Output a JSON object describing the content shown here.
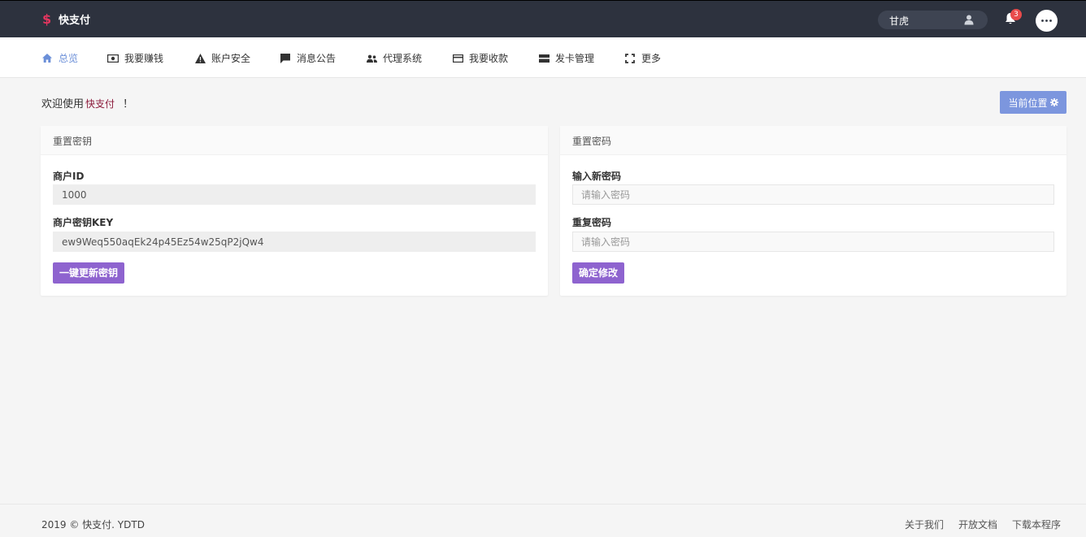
{
  "header": {
    "brand_symbol": "$",
    "brand_name": "快支付",
    "username": "甘虎",
    "notification_count": "3",
    "brand_color": "#e2365f",
    "bg_color": "#2d323e"
  },
  "nav": {
    "items": [
      {
        "label": "总览",
        "icon": "home-icon",
        "active": true
      },
      {
        "label": "我要赚钱",
        "icon": "money-icon"
      },
      {
        "label": "账户安全",
        "icon": "warning-icon"
      },
      {
        "label": "消息公告",
        "icon": "message-icon"
      },
      {
        "label": "代理系统",
        "icon": "users-icon"
      },
      {
        "label": "我要收款",
        "icon": "card-icon"
      },
      {
        "label": "发卡管理",
        "icon": "card-manage-icon"
      },
      {
        "label": "更多",
        "icon": "expand-icon"
      }
    ],
    "active_color": "#6b8fd8"
  },
  "main": {
    "welcome_prefix": "欢迎使用",
    "welcome_site": "快支付",
    "welcome_suffix": "！",
    "location_button": "当前位置"
  },
  "reset_key": {
    "title": "重置密钥",
    "merchant_id_label": "商户ID",
    "merchant_id_value": "1000",
    "key_label": "商户密钥KEY",
    "key_value": "ew9Weq550aqEk24p45Ez54w25qP2jQw4",
    "button": "一键更新密钥"
  },
  "reset_password": {
    "title": "重置密码",
    "new_password_label": "输入新密码",
    "new_password_placeholder": "请输入密码",
    "repeat_password_label": "重复密码",
    "repeat_password_placeholder": "请输入密码",
    "button": "确定修改"
  },
  "footer": {
    "copyright": "2019 © 快支付. YDTD",
    "links": [
      "关于我们",
      "开放文档",
      "下载本程序"
    ]
  },
  "colors": {
    "primary_button": "#8e63cf",
    "location_button": "#7c96de"
  }
}
